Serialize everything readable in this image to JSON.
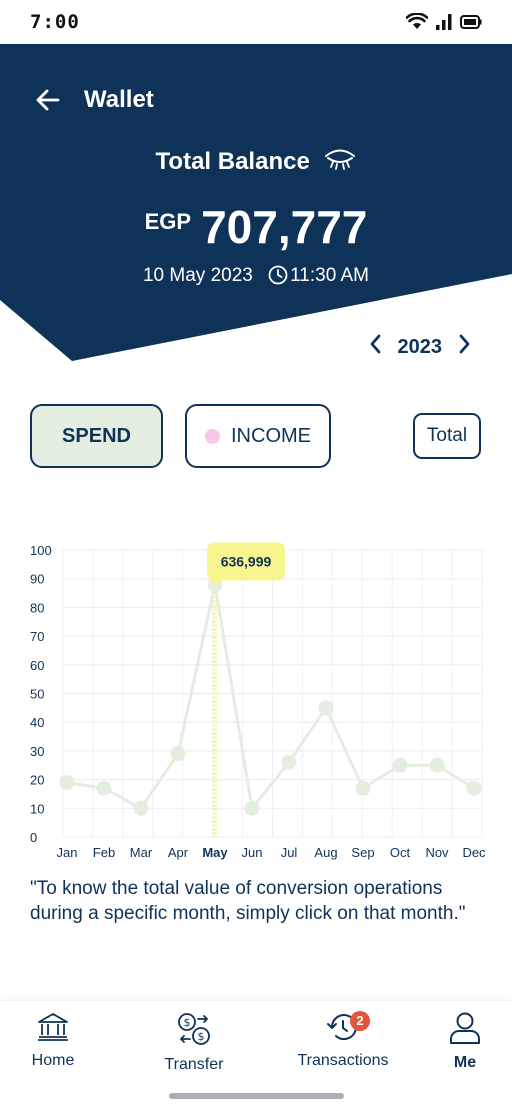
{
  "status_bar": {
    "time": "7:00",
    "icons": [
      "wifi-icon",
      "signal-icon",
      "battery-icon"
    ]
  },
  "header": {
    "title": "Wallet",
    "balance_label": "Total Balance",
    "currency": "EGP",
    "amount": "707,777",
    "date": "10 May 2023",
    "time": "11:30 AM",
    "background_color": "#0f3358"
  },
  "year_nav": {
    "year": "2023"
  },
  "tabs": {
    "spend": "SPEND",
    "income": "INCOME",
    "total": "Total"
  },
  "chart_data": {
    "type": "line",
    "categories": [
      "Jan",
      "Feb",
      "Mar",
      "Apr",
      "May",
      "Jun",
      "Jul",
      "Aug",
      "Sep",
      "Oct",
      "Nov",
      "Dec"
    ],
    "values": [
      19,
      17,
      10,
      29,
      88,
      10,
      26,
      45,
      17,
      25,
      25,
      17
    ],
    "y_ticks": [
      0,
      10,
      20,
      30,
      40,
      50,
      60,
      70,
      80,
      90,
      100
    ],
    "ylim": [
      0,
      100
    ],
    "selected_category": "May",
    "tooltip": "636,999",
    "line_color": "#e3ede0",
    "highlight_color": "#f8f58f",
    "grid": true
  },
  "quote": "\"To know the total value of conversion operations during a specific month, simply click on that month.\"",
  "bottom_nav": [
    {
      "label": "Home",
      "icon": "bank-icon"
    },
    {
      "label": "Transfer",
      "icon": "transfer-icon"
    },
    {
      "label": "Transactions",
      "icon": "history-icon",
      "badge": "2"
    },
    {
      "label": "Me",
      "icon": "person-icon"
    }
  ]
}
